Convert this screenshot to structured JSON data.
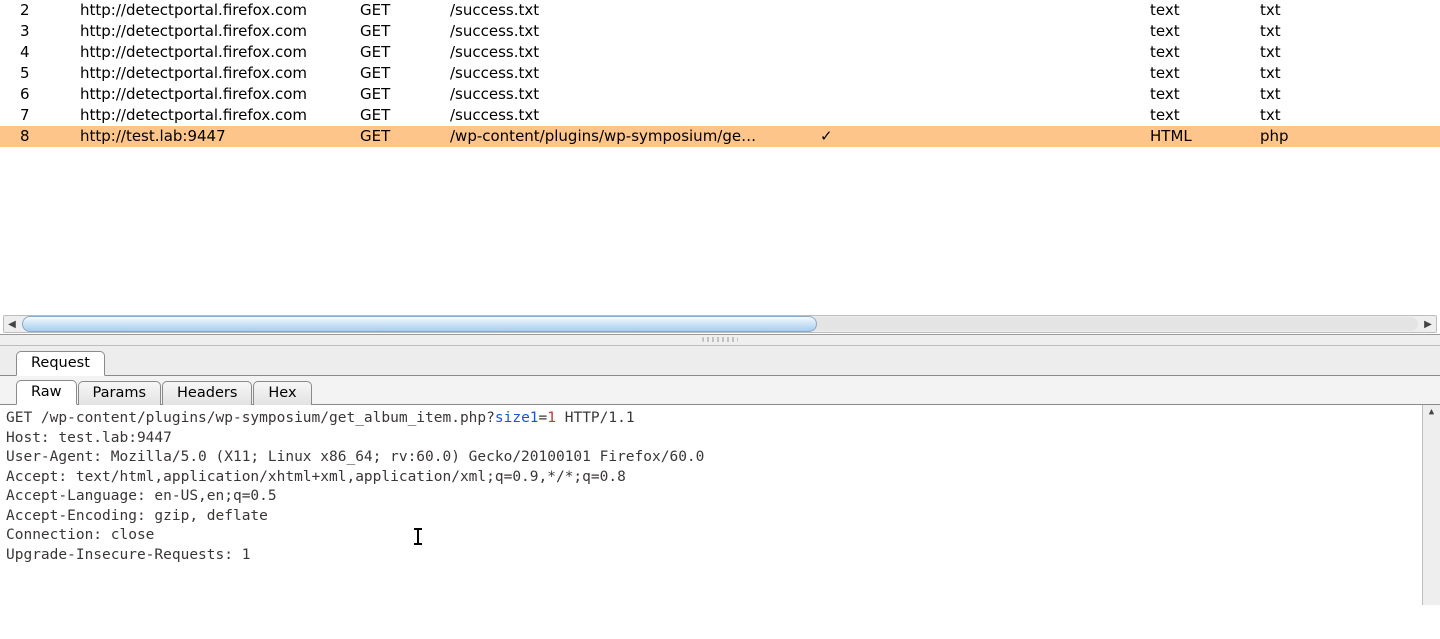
{
  "history": {
    "rows": [
      {
        "index": "2",
        "host": "http://detectportal.firefox.com",
        "method": "GET",
        "url": "/success.txt",
        "check": "",
        "ext1": "text",
        "ext2": "txt",
        "selected": false
      },
      {
        "index": "3",
        "host": "http://detectportal.firefox.com",
        "method": "GET",
        "url": "/success.txt",
        "check": "",
        "ext1": "text",
        "ext2": "txt",
        "selected": false
      },
      {
        "index": "4",
        "host": "http://detectportal.firefox.com",
        "method": "GET",
        "url": "/success.txt",
        "check": "",
        "ext1": "text",
        "ext2": "txt",
        "selected": false
      },
      {
        "index": "5",
        "host": "http://detectportal.firefox.com",
        "method": "GET",
        "url": "/success.txt",
        "check": "",
        "ext1": "text",
        "ext2": "txt",
        "selected": false
      },
      {
        "index": "6",
        "host": "http://detectportal.firefox.com",
        "method": "GET",
        "url": "/success.txt",
        "check": "",
        "ext1": "text",
        "ext2": "txt",
        "selected": false
      },
      {
        "index": "7",
        "host": "http://detectportal.firefox.com",
        "method": "GET",
        "url": "/success.txt",
        "check": "",
        "ext1": "text",
        "ext2": "txt",
        "selected": false
      },
      {
        "index": "8",
        "host": "http://test.lab:9447",
        "method": "GET",
        "url": "/wp-content/plugins/wp-symposium/ge…",
        "check": "✓",
        "ext1": "HTML",
        "ext2": "php",
        "selected": true
      }
    ]
  },
  "detail": {
    "upper_tabs": [
      {
        "label": "Request",
        "active": true
      }
    ],
    "lower_tabs": [
      {
        "label": "Raw",
        "active": true
      },
      {
        "label": "Params",
        "active": false
      },
      {
        "label": "Headers",
        "active": false
      },
      {
        "label": "Hex",
        "active": false
      }
    ],
    "raw": {
      "line0_pre": "GET /wp-content/plugins/wp-symposium/get_album_item.php?",
      "line0_param_name": "size1",
      "line0_param_value": "1",
      "line0_post": " HTTP/1.1",
      "lines": [
        "Host: test.lab:9447",
        "User-Agent: Mozilla/5.0 (X11; Linux x86_64; rv:60.0) Gecko/20100101 Firefox/60.0",
        "Accept: text/html,application/xhtml+xml,application/xml;q=0.9,*/*;q=0.8",
        "Accept-Language: en-US,en;q=0.5",
        "Accept-Encoding: gzip, deflate",
        "Connection: close",
        "Upgrade-Insecure-Requests: 1"
      ]
    }
  }
}
